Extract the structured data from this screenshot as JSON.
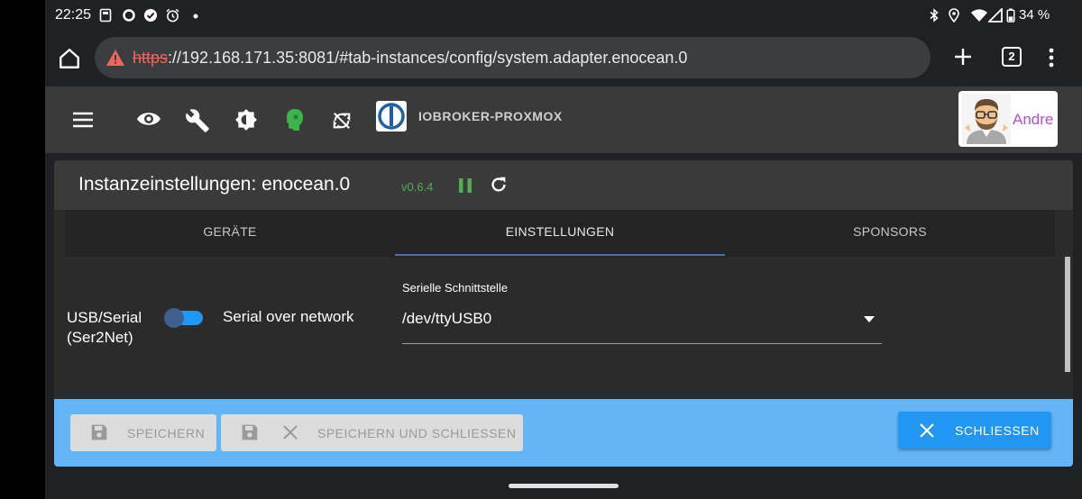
{
  "status_bar": {
    "time": "22:25",
    "battery": "34 %",
    "left_icons": [
      "sim-icon",
      "circle-icon",
      "check-circle-icon",
      "alarm-icon",
      "dot-icon"
    ],
    "right_icons": [
      "bluetooth-icon",
      "location-icon",
      "wifi-icon",
      "signal-icon",
      "battery-icon"
    ]
  },
  "browser": {
    "url_scheme": "https",
    "url_rest": "://192.168.171.35:8081/#tab-instances/config/system.adapter.enocean.0",
    "tab_count": "2"
  },
  "app_toolbar": {
    "brand": "IOBROKER-PROXMOX",
    "user_name": "Andre"
  },
  "dialog": {
    "title": "Instanzeinstellungen: enocean.0",
    "version": "v0.6.4",
    "tabs": [
      {
        "label": "GERÄTE"
      },
      {
        "label": "EINSTELLUNGEN"
      },
      {
        "label": "SPONSORS"
      }
    ],
    "active_tab": 1,
    "settings": {
      "switch_left_label_1": "USB/Serial",
      "switch_left_label_2": "(Ser2Net)",
      "switch_right_label": "Serial over network",
      "serial_label": "Serielle Schnittstelle",
      "serial_value": "/dev/ttyUSB0"
    },
    "footer": {
      "save_label": "SPEICHERN",
      "save_close_label": "SPEICHERN UND SCHLIESSEN",
      "close_label": "SCHLIESSEN"
    }
  },
  "colors": {
    "footer_bg": "#64b5f6",
    "primary": "#2196f3",
    "version_green": "#4caf50",
    "user_name": "#b14ed8"
  }
}
